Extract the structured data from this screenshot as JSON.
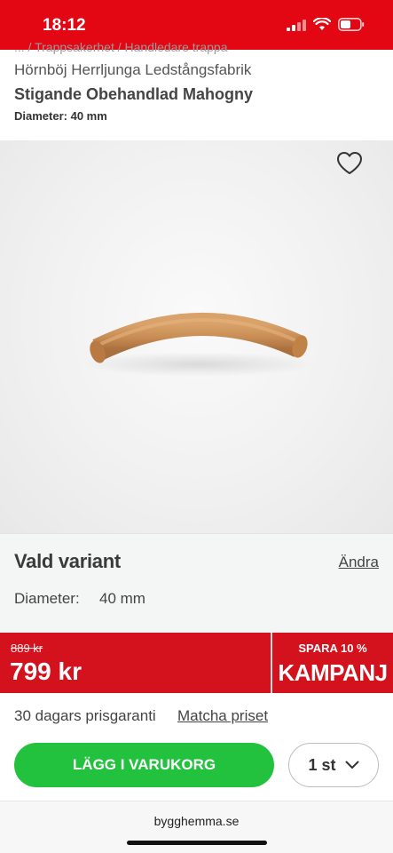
{
  "status_bar": {
    "time": "18:12"
  },
  "breadcrumb": "... / Trappsakerhet / Handledare trappa",
  "product": {
    "brand": "Hörnböj Herrljunga Ledstångsfabrik",
    "title": "Stigande Obehandlad Mahogny",
    "spec_label": "Diameter:",
    "spec_value": "40 mm"
  },
  "variant": {
    "heading": "Vald variant",
    "change_link": "Ändra",
    "diameter_label": "Diameter:",
    "diameter_value": "40 mm"
  },
  "price": {
    "old": "889 kr",
    "current": "799 kr",
    "save_label": "SPARA 10 %",
    "campaign": "KAMPANJ"
  },
  "guarantee": {
    "text": "30 dagars prisgaranti",
    "match_link": "Matcha priset"
  },
  "cart": {
    "add_button": "LÄGG I VARUKORG",
    "quantity": "1 st"
  },
  "browser": {
    "url": "bygghemma.se"
  },
  "icons": {
    "favorite": "heart-icon",
    "quantity_dropdown": "chevron-down-icon",
    "signal": "signal-icon",
    "wifi": "wifi-icon",
    "battery": "battery-icon"
  },
  "colors": {
    "status_bar": "#e30613",
    "price_bar": "#d4121e",
    "add_button": "#23c23e"
  }
}
